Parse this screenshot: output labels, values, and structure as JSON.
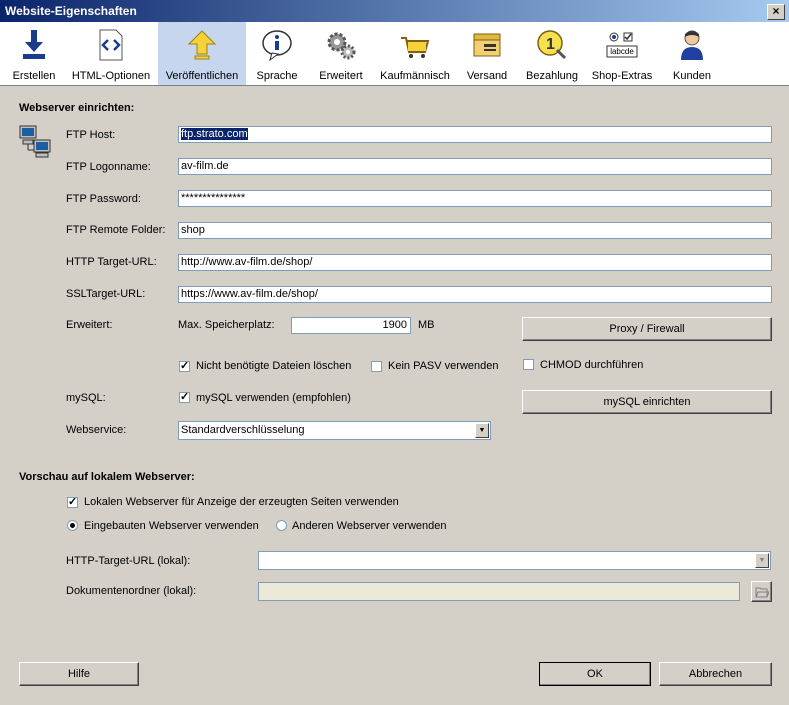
{
  "window": {
    "title": "Website-Eigenschaften"
  },
  "toolbar": {
    "items": [
      {
        "label": "Erstellen",
        "icon": "download-arrow-icon"
      },
      {
        "label": "HTML-Optionen",
        "icon": "html-code-icon"
      },
      {
        "label": "Veröffentlichen",
        "icon": "upload-arrow-icon",
        "active": true
      },
      {
        "label": "Sprache",
        "icon": "speech-info-icon"
      },
      {
        "label": "Erweitert",
        "icon": "gears-icon"
      },
      {
        "label": "Kaufmännisch",
        "icon": "shopping-cart-icon"
      },
      {
        "label": "Versand",
        "icon": "package-icon"
      },
      {
        "label": "Bezahlung",
        "icon": "coin-icon"
      },
      {
        "label": "Shop-Extras",
        "icon": "form-controls-icon",
        "icon_text": "labcde"
      },
      {
        "label": "Kunden",
        "icon": "customer-icon"
      }
    ]
  },
  "webserver": {
    "heading": "Webserver einrichten:",
    "ftp_host_label": "FTP Host:",
    "ftp_host": "ftp.strato.com",
    "ftp_login_label": "FTP Logonname:",
    "ftp_login": "av-film.de",
    "ftp_password_label": "FTP Password:",
    "ftp_password": "***************",
    "ftp_folder_label": "FTP Remote Folder:",
    "ftp_folder": "shop",
    "http_url_label": "HTTP Target-URL:",
    "http_url": "http://www.av-film.de/shop/",
    "ssl_url_label": "SSLTarget-URL:",
    "ssl_url": "https://www.av-film.de/shop/",
    "advanced_label": "Erweitert:",
    "max_storage_label": "Max. Speicherplatz:",
    "max_storage": "1900",
    "max_storage_unit": "MB",
    "proxy_button": "Proxy / Firewall",
    "delete_unused_label": "Nicht benötigte Dateien löschen",
    "delete_unused": true,
    "no_pasv_label": "Kein PASV verwenden",
    "no_pasv": false,
    "chmod_label": "CHMOD durchführen",
    "chmod": false,
    "mysql_label": "mySQL:",
    "use_mysql_label": "mySQL verwenden (empfohlen)",
    "use_mysql": true,
    "mysql_button": "mySQL einrichten",
    "webservice_label": "Webservice:",
    "webservice": "Standardverschlüsselung"
  },
  "preview": {
    "heading": "Vorschau auf lokalem Webserver:",
    "use_local_label": "Lokalen Webserver für Anzeige der erzeugten Seiten verwenden",
    "use_local": true,
    "builtin_label": "Eingebauten Webserver verwenden",
    "other_label": "Anderen Webserver verwenden",
    "selected_server": "builtin",
    "local_url_label": "HTTP-Target-URL (lokal):",
    "local_url": "",
    "doc_folder_label": "Dokumentenordner (lokal):",
    "doc_folder": ""
  },
  "footer": {
    "help": "Hilfe",
    "ok": "OK",
    "cancel": "Abbrechen"
  }
}
